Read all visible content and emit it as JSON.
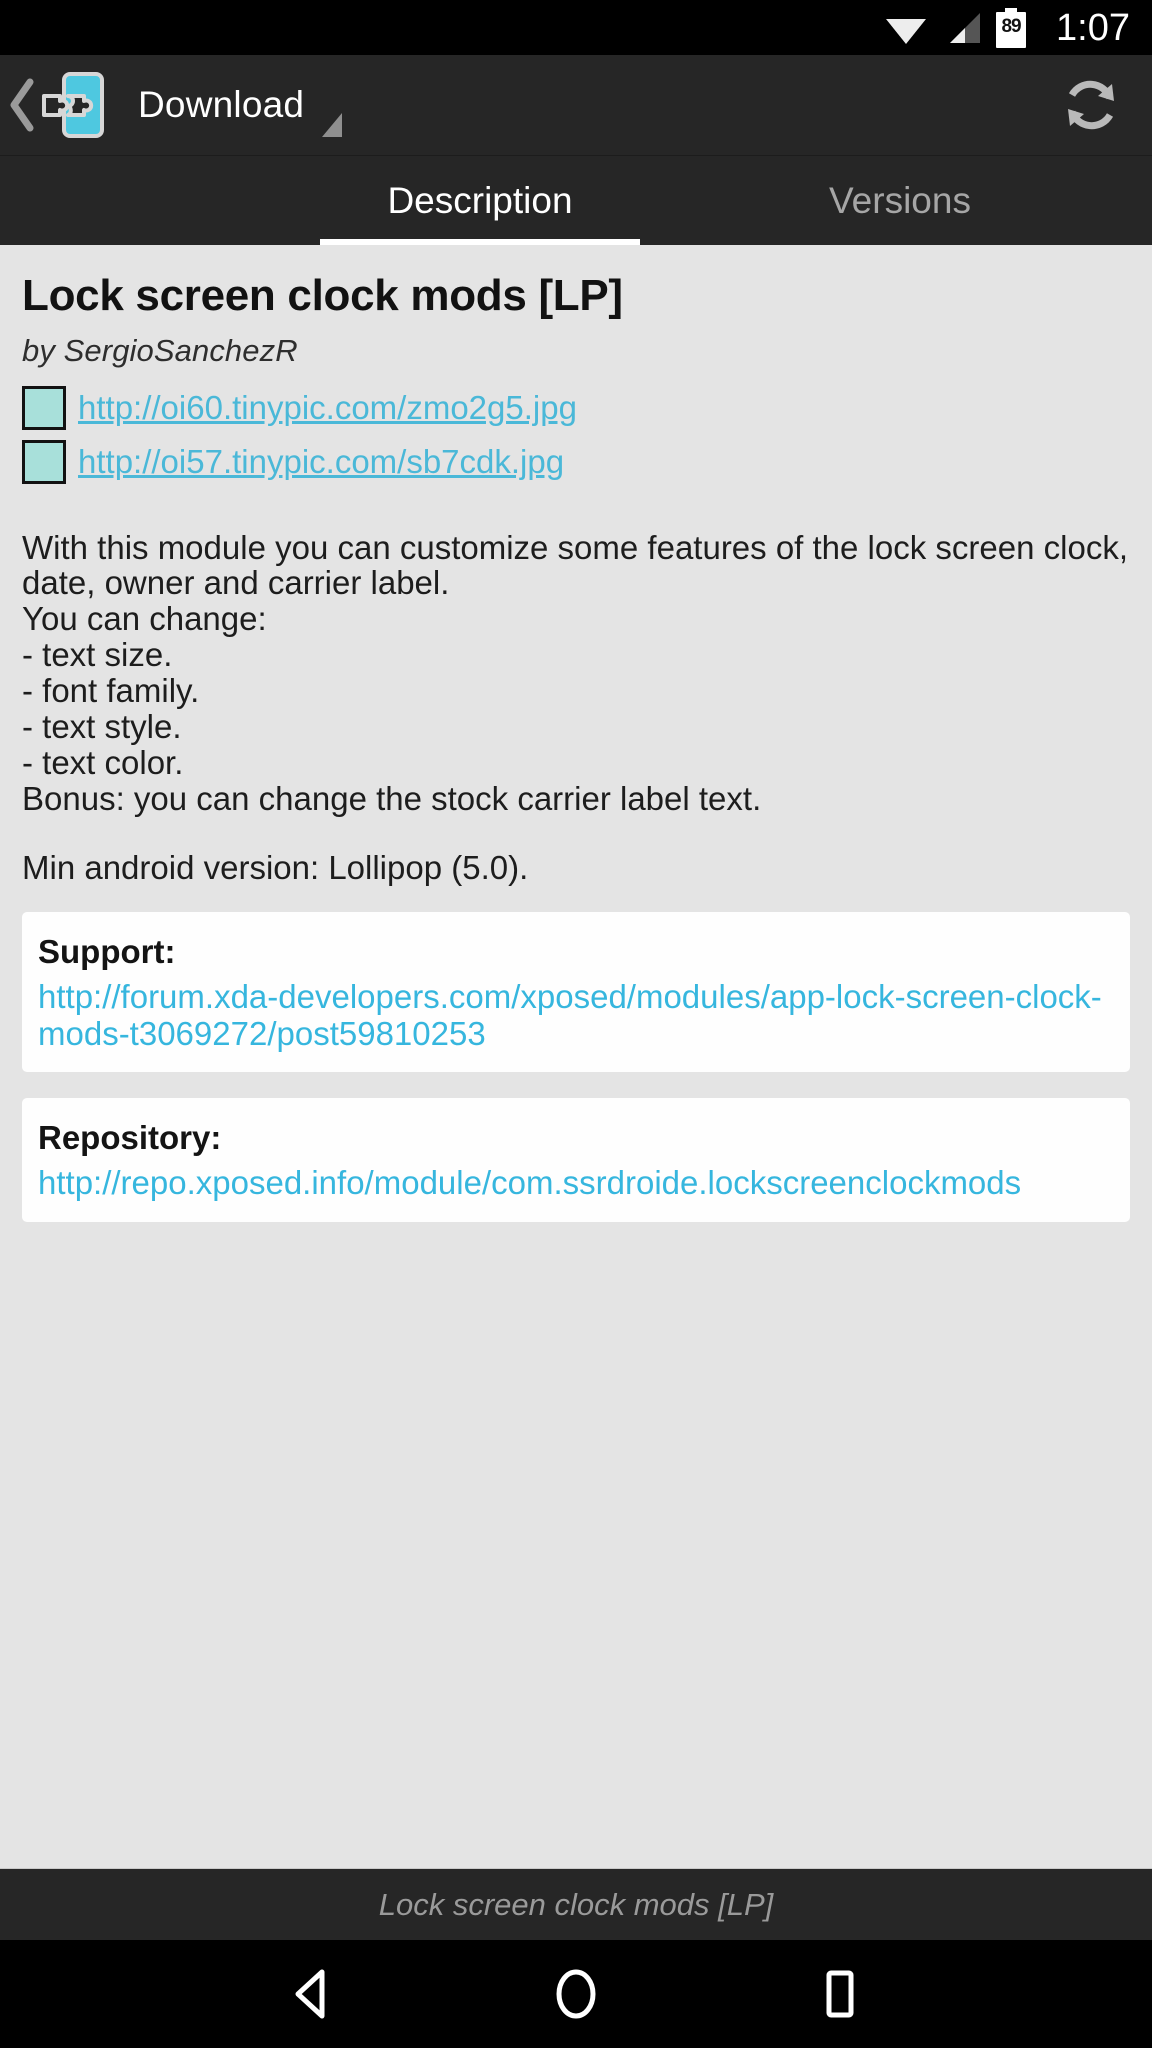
{
  "status_bar": {
    "wifi_icon": "wifi-icon",
    "signal_icon": "cell-signal-icon",
    "battery_icon": "battery-icon",
    "battery_level": "89",
    "time": "1:07"
  },
  "action_bar": {
    "app_icon": "xposed-module-icon",
    "back_icon": "back-chevron-icon",
    "title": "Download",
    "spinner_caret_icon": "dropdown-caret-icon",
    "refresh_icon": "refresh-icon"
  },
  "tabs": [
    {
      "label": "Description",
      "active": true
    },
    {
      "label": "Versions",
      "active": false
    }
  ],
  "module": {
    "title": "Lock screen clock mods [LP]",
    "author": "by SergioSanchezR",
    "image_links": [
      {
        "url": "http://oi60.tinypic.com/zmo2g5.jpg",
        "placeholder_icon": "broken-image-icon"
      },
      {
        "url": "http://oi57.tinypic.com/sb7cdk.jpg",
        "placeholder_icon": "broken-image-icon"
      }
    ],
    "description_lines": [
      "With this module you can customize some features of the lock screen clock, date, owner and carrier label.",
      "You can change:",
      "- text size.",
      "- font family.",
      "- text style.",
      "- text color.",
      "Bonus: you can change the stock carrier label text."
    ],
    "min_version_line": "Min android version: Lollipop (5.0)."
  },
  "support_card": {
    "heading": "Support:",
    "url": "http://forum.xda-developers.com/xposed/modules/app-lock-screen-clock-mods-t3069272/post59810253"
  },
  "repository_card": {
    "heading": "Repository:",
    "url": "http://repo.xposed.info/module/com.ssrdroide.lockscreenclockmods"
  },
  "bottom_bar": {
    "text": "Lock screen clock mods [LP]"
  },
  "nav_bar": {
    "back_icon": "nav-back-triangle-icon",
    "home_icon": "nav-home-circle-icon",
    "recents_icon": "nav-recents-square-icon"
  },
  "colors": {
    "accent_cyan": "#36b6de",
    "link_cyan": "#4ab8d8",
    "chrome_dark": "#262626",
    "page_bg": "#e4e4e4",
    "card_bg": "#fefefe",
    "icon_cyan": "#4ec8e0"
  }
}
